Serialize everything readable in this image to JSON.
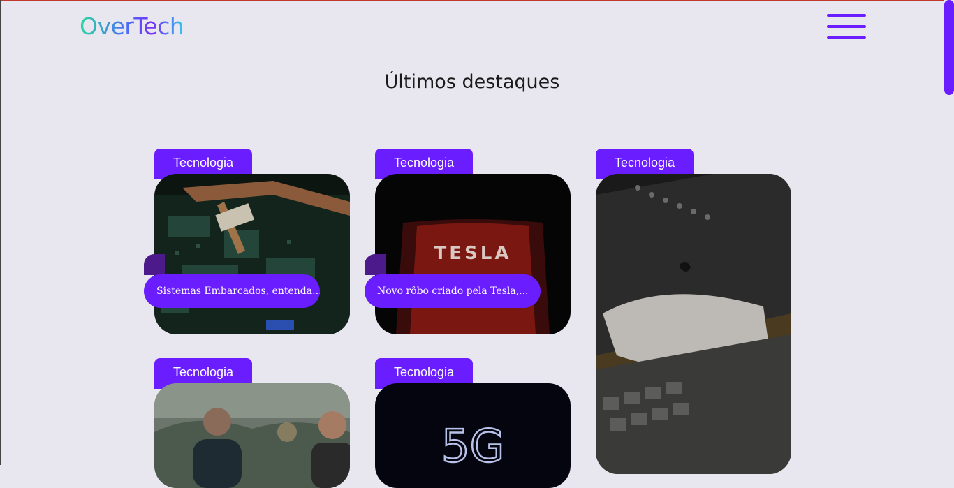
{
  "header": {
    "logo": "OverTech"
  },
  "section": {
    "title": "Últimos destaques"
  },
  "cards": [
    {
      "tag": "Tecnologia",
      "caption": "Sistemas Embarcados, entenda...",
      "image": "circuit-board"
    },
    {
      "tag": "Tecnologia",
      "caption": "Novo rôbo criado pela Tesla,...",
      "image": "tesla-logo",
      "image_text": "TESLA"
    },
    {
      "tag": "Tecnologia",
      "caption": "",
      "image": "laptop-keyboard"
    },
    {
      "tag": "Tecnologia",
      "caption": "",
      "image": "metaverse-avatars"
    },
    {
      "tag": "Tecnologia",
      "caption": "",
      "image": "5g-text",
      "image_text": "5G"
    }
  ],
  "colors": {
    "accent": "#6a1dff",
    "background": "#e8e7f0"
  }
}
